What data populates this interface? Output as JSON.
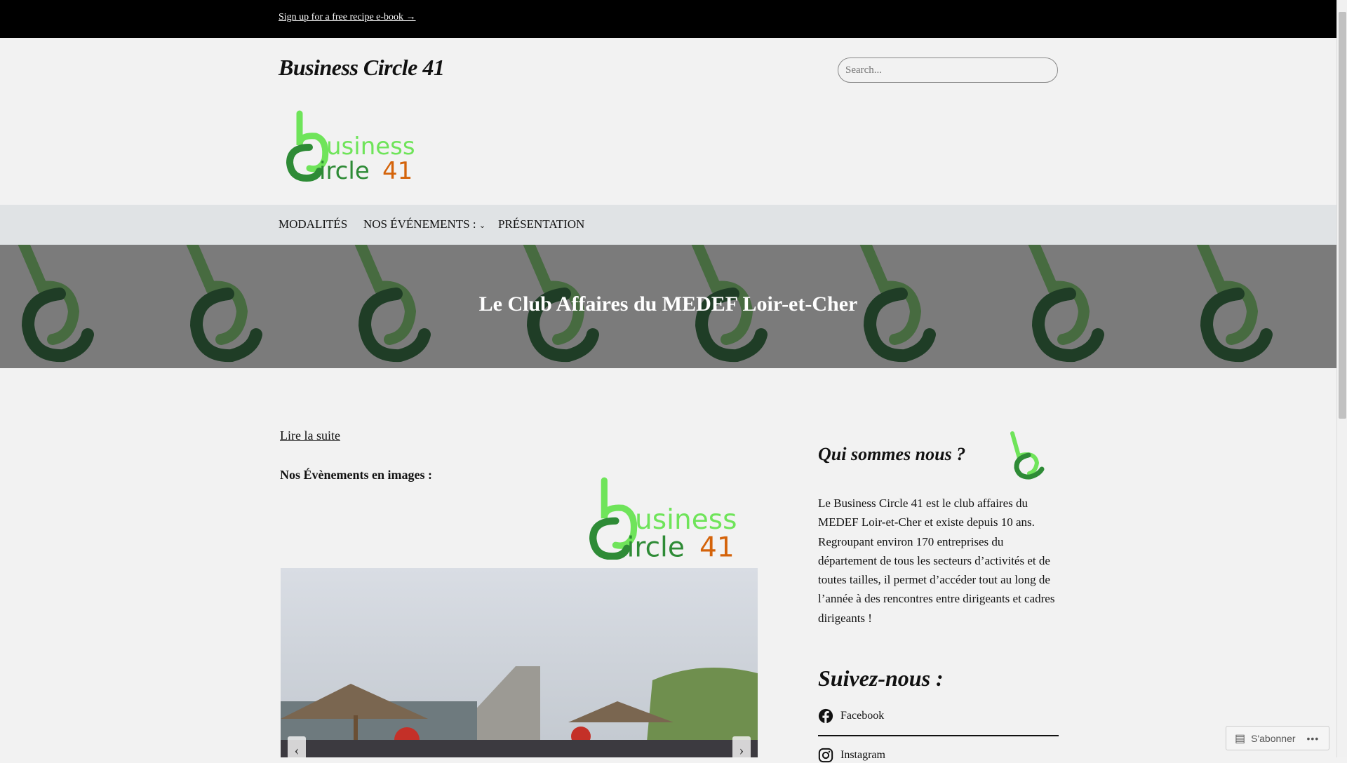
{
  "announcement": {
    "link": "Sign up for a free recipe e-book →"
  },
  "header": {
    "site_title": "Business Circle 41",
    "search_placeholder": "Search...",
    "logo_text": "business Circle 41"
  },
  "nav": {
    "items": [
      {
        "label": "MODALITÉS"
      },
      {
        "label": "NOS ÉVÉNEMENTS :",
        "has_dropdown": true
      },
      {
        "label": "PRÉSENTATION"
      }
    ]
  },
  "hero": {
    "title": "Le Club Affaires du MEDEF Loir-et-Cher"
  },
  "main": {
    "read_more": "Lire la suite",
    "events_heading": "Nos Évènements en images :",
    "slider": {
      "prev": "‹",
      "next": "›"
    }
  },
  "sidebar": {
    "about_heading": "Qui sommes nous ?",
    "about_text": "Le Business Circle 41 est le club affaires du MEDEF Loir-et-Cher et existe depuis 10 ans. Regroupant environ 170 entreprises du département de tous les secteurs d’activités et de toutes tailles, il permet d’accéder tout au long de l’année à des rencontres entre dirigeants et cadres dirigeants !",
    "follow_heading": "Suivez-nous :",
    "social": [
      {
        "label": "Facebook",
        "icon": "facebook-icon"
      },
      {
        "label": "Instagram",
        "icon": "instagram-icon"
      }
    ]
  },
  "subscribe": {
    "label": "S'abonner",
    "more": "•••"
  },
  "colors": {
    "green_light": "#6fe45a",
    "green_dark": "#2e8b36",
    "orange": "#d4630a",
    "nav_bg": "#e0e3e5"
  }
}
